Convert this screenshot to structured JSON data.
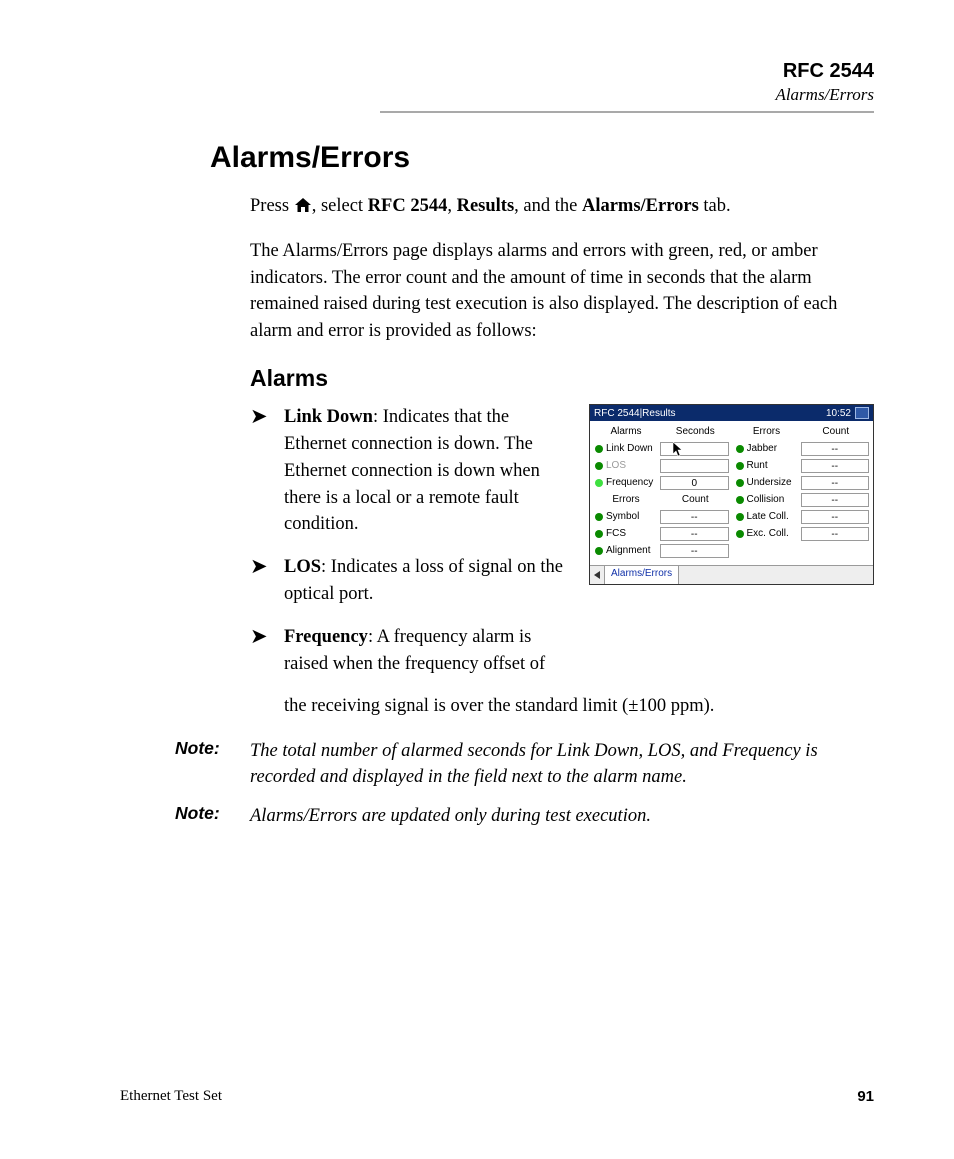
{
  "header": {
    "title": "RFC 2544",
    "subtitle": "Alarms/Errors"
  },
  "section_title": "Alarms/Errors",
  "intro": {
    "press": "Press ",
    "select": ", select ",
    "rfc": "RFC 2544",
    "comma1": ", ",
    "results": "Results",
    "and_the": ", and the ",
    "ae": "Alarms/Errors",
    "tab": " tab."
  },
  "desc_para": "The Alarms/Errors page displays alarms and errors with green, red, or amber indicators. The error count and the amount of time in seconds that the alarm remained raised during test execution is also displayed. The description of each alarm and error is provided as follows:",
  "subsection_title": "Alarms",
  "bullets": [
    {
      "term": "Link Down",
      "rest": ": Indicates that the Ethernet connection is down. The Ethernet connection is down when there is a local or a remote fault condition."
    },
    {
      "term": "LOS",
      "rest": ": Indicates a loss of signal on the optical port."
    },
    {
      "term": "Frequency",
      "rest": ": A frequency alarm is raised when the frequency offset of"
    }
  ],
  "continuation": "the receiving signal is over the standard limit (±100 ppm).",
  "notes": [
    {
      "label": "Note:",
      "text": "The total number of alarmed seconds for Link Down, LOS, and Frequency is recorded and displayed in the field next to the alarm name."
    },
    {
      "label": "Note:",
      "text": "Alarms/Errors are updated only during test execution."
    }
  ],
  "footer": {
    "left": "Ethernet Test Set",
    "right": "91"
  },
  "screenshot": {
    "title": "RFC 2544|Results",
    "clock": "10:52",
    "left": {
      "hdr1_a": "Alarms",
      "hdr1_b": "Seconds",
      "rows_a": [
        {
          "ind": "green",
          "label": "Link Down",
          "val": "",
          "cursor": true
        },
        {
          "ind": "green",
          "label": "LOS",
          "val": "",
          "dim": true
        },
        {
          "ind": "lime",
          "label": "Frequency",
          "val": "0"
        }
      ],
      "hdr2_a": "Errors",
      "hdr2_b": "Count",
      "rows_b": [
        {
          "ind": "green",
          "label": "Symbol",
          "val": "--"
        },
        {
          "ind": "green",
          "label": "FCS",
          "val": "--"
        },
        {
          "ind": "green",
          "label": "Alignment",
          "val": "--"
        }
      ]
    },
    "right": {
      "hdr_a": "Errors",
      "hdr_b": "Count",
      "rows": [
        {
          "ind": "green",
          "label": "Jabber",
          "val": "--"
        },
        {
          "ind": "green",
          "label": "Runt",
          "val": "--"
        },
        {
          "ind": "green",
          "label": "Undersize",
          "val": "--"
        },
        {
          "ind": "green",
          "label": "Collision",
          "val": "--"
        },
        {
          "ind": "green",
          "label": "Late Coll.",
          "val": "--"
        },
        {
          "ind": "green",
          "label": "Exc. Coll.",
          "val": "--"
        }
      ]
    },
    "tab": "Alarms/Errors"
  }
}
